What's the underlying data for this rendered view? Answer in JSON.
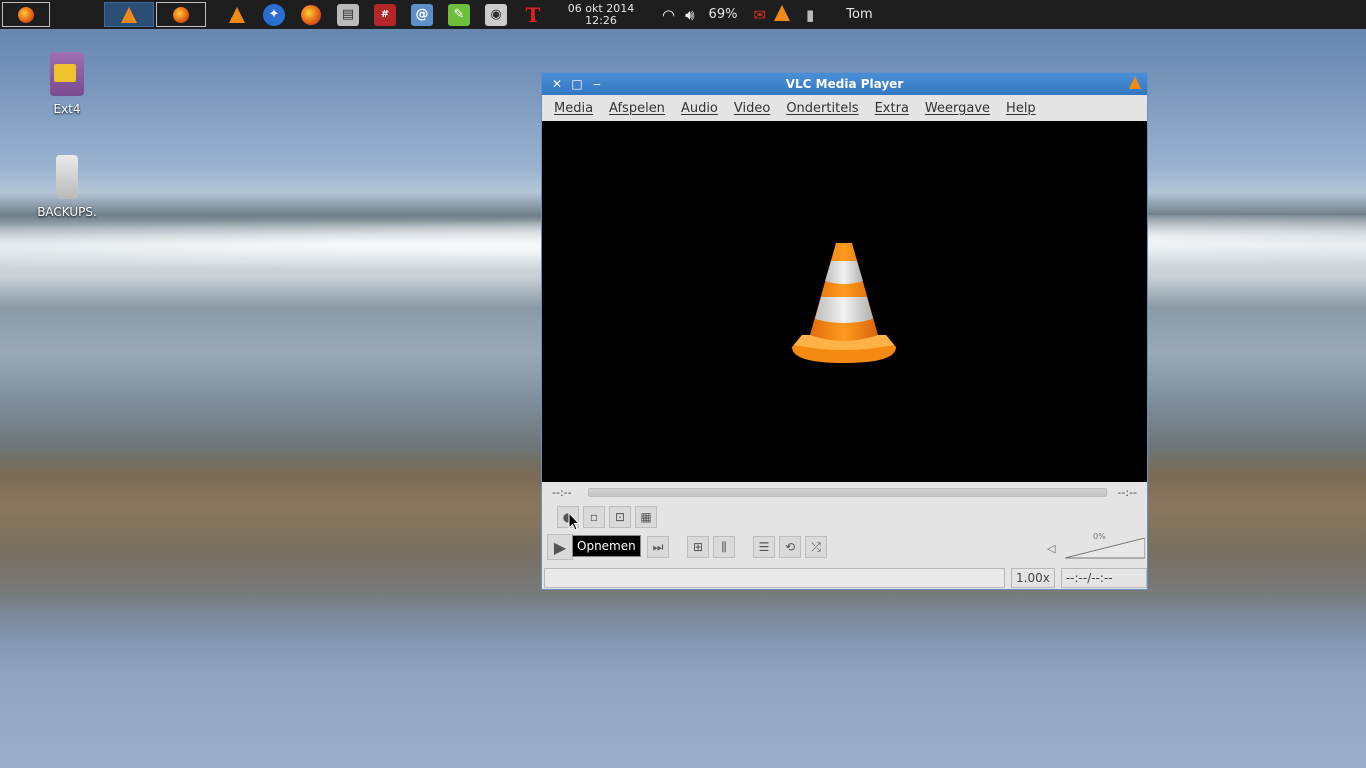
{
  "taskbar": {
    "clock_date": "06 okt 2014",
    "clock_time": "12:26",
    "battery": "69%",
    "user": "Tom"
  },
  "desktop": {
    "icons": [
      {
        "label": "Ext4"
      },
      {
        "label": "BACKUPS."
      }
    ]
  },
  "vlc": {
    "title": "VLC Media Player",
    "menu": [
      "Media",
      "Afspelen",
      "Audio",
      "Video",
      "Ondertitels",
      "Extra",
      "Weergave",
      "Help"
    ],
    "elapsed": "--:--",
    "remaining": "--:--",
    "tooltip": "Opnemen",
    "volume_percent": "0%",
    "speed": "1.00x",
    "time_total": "--:--/--:--"
  },
  "colors": {
    "titlebar": "#3a82cf",
    "accent_orange": "#f18a14"
  }
}
